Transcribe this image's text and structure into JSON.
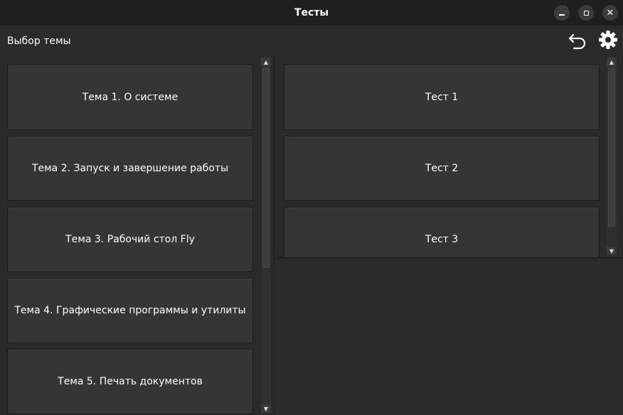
{
  "window": {
    "title": "Тесты",
    "minimize_icon": "minimize-icon",
    "maximize_icon": "maximize-icon",
    "close_icon": "close-icon",
    "close_glyph": "✕"
  },
  "toolbar": {
    "label": "Выбор темы",
    "back_icon": "back-arrow-icon",
    "settings_icon": "gear-icon"
  },
  "topics": [
    {
      "label": "Тема 1. О системе"
    },
    {
      "label": "Тема 2. Запуск и завершение работы"
    },
    {
      "label": "Тема 3. Рабочий стол Fly"
    },
    {
      "label": "Тема 4. Графические программы и утилиты"
    },
    {
      "label": "Тема 5. Печать документов"
    }
  ],
  "tests": [
    {
      "label": "Тест 1"
    },
    {
      "label": "Тест 2"
    },
    {
      "label": "Тест 3"
    }
  ],
  "scroll": {
    "up_glyph": "▲",
    "down_glyph": "▼"
  },
  "colors": {
    "background": "#2b2b2b",
    "titlebar": "#1f1f1f",
    "button": "#353535",
    "text": "#ffffff"
  }
}
